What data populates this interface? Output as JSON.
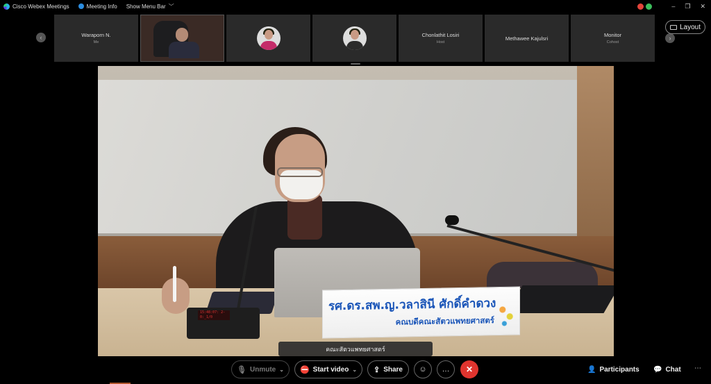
{
  "topbar": {
    "app_name": "Cisco Webex Meetings",
    "meeting_info": "Meeting Info",
    "show_menu_bar": "Show Menu Bar",
    "window_controls": {
      "minimize": "–",
      "restore": "❐",
      "close": "✕"
    }
  },
  "participants": [
    {
      "name": "Waraporn N.",
      "role": "Me",
      "kind": "name"
    },
    {
      "name": "",
      "role": "",
      "kind": "video"
    },
    {
      "name": "",
      "role": "",
      "kind": "avatar"
    },
    {
      "name": "",
      "role": "",
      "kind": "avatar"
    },
    {
      "name": "Chonlathit Losiri",
      "role": "Host",
      "kind": "name"
    },
    {
      "name": "Methawee Kajulsri",
      "role": "",
      "kind": "name"
    },
    {
      "name": "Monitor",
      "role": "Cohost",
      "kind": "name"
    }
  ],
  "layout_button": "Layout",
  "main_video": {
    "nameplate_line1": "รศ.ดร.สพ.ญ.วลาสินี ศักดิ์คำดวง",
    "nameplate_line2": "คณบดีคณะสัตวแพทยศาสตร์",
    "mic_display": "15:48:07: 2-0:_1/0",
    "caption": "คณะสัตวแพทยศาสตร์"
  },
  "toolbar": {
    "unmute": "Unmute",
    "start_video": "Start video",
    "share": "Share",
    "participants": "Participants",
    "chat": "Chat",
    "more": "…"
  },
  "colors": {
    "end_call": "#e0342e",
    "accent_blue": "#1a55b8"
  }
}
